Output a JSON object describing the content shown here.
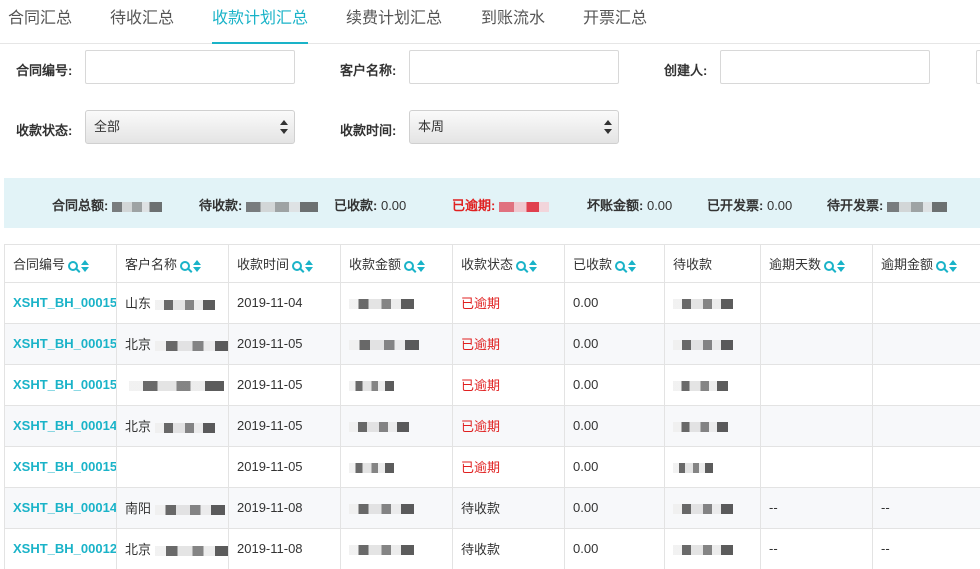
{
  "tabs": [
    {
      "label": "合同汇总",
      "active": false
    },
    {
      "label": "待收汇总",
      "active": false
    },
    {
      "label": "收款计划汇总",
      "active": true
    },
    {
      "label": "续费计划汇总",
      "active": false
    },
    {
      "label": "到账流水",
      "active": false
    },
    {
      "label": "开票汇总",
      "active": false
    }
  ],
  "filters": {
    "contract_no_label": "合同编号:",
    "customer_name_label": "客户名称:",
    "creator_label": "创建人:",
    "status_label": "收款状态:",
    "status_value": "全部",
    "time_label": "收款时间:",
    "time_value": "本周"
  },
  "summary": {
    "total_label": "合同总额:",
    "pending_label": "待收款:",
    "received_label": "已收款:",
    "received_value": "0.00",
    "overdue_label": "已逾期:",
    "bad_debt_label": "坏账金额:",
    "bad_debt_value": "0.00",
    "invoiced_label": "已开发票:",
    "invoiced_value": "0.00",
    "to_invoice_label": "待开发票:"
  },
  "table": {
    "columns": [
      "合同编号",
      "客户名称",
      "收款时间",
      "收款金额",
      "收款状态",
      "已收款",
      "待收款",
      "逾期天数",
      "逾期金额"
    ],
    "rows": [
      {
        "code": "XSHT_BH_00015",
        "customer": "山东",
        "date": "2019-11-04",
        "status": "已逾期",
        "received": "0.00",
        "overdue_days": "",
        "overdue_amount": ""
      },
      {
        "code": "XSHT_BH_00015",
        "customer": "北京",
        "date": "2019-11-05",
        "status": "已逾期",
        "received": "0.00",
        "overdue_days": "",
        "overdue_amount": ""
      },
      {
        "code": "XSHT_BH_00015",
        "customer": "",
        "date": "2019-11-05",
        "status": "已逾期",
        "received": "0.00",
        "overdue_days": "",
        "overdue_amount": ""
      },
      {
        "code": "XSHT_BH_00014",
        "customer": "北京",
        "date": "2019-11-05",
        "status": "已逾期",
        "received": "0.00",
        "overdue_days": "",
        "overdue_amount": ""
      },
      {
        "code": "XSHT_BH_00015",
        "customer": "",
        "date": "2019-11-05",
        "status": "已逾期",
        "received": "0.00",
        "overdue_days": "",
        "overdue_amount": ""
      },
      {
        "code": "XSHT_BH_00014",
        "customer": "南阳",
        "date": "2019-11-08",
        "status": "待收款",
        "received": "0.00",
        "overdue_days": "--",
        "overdue_amount": "--"
      },
      {
        "code": "XSHT_BH_00012",
        "customer": "北京",
        "date": "2019-11-08",
        "status": "待收款",
        "received": "0.00",
        "overdue_days": "--",
        "overdue_amount": "--"
      }
    ]
  },
  "colors": {
    "accent": "#1ab3c8",
    "overdue": "#e02020",
    "summary_bg": "#e2f3f7"
  },
  "icons": [
    "search-icon",
    "sort-icon",
    "select-arrows-icon"
  ]
}
